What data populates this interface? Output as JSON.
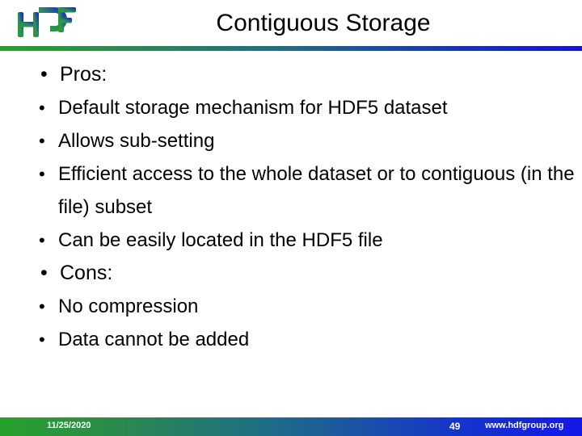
{
  "header": {
    "title": "Contiguous Storage",
    "logo_alt": "HDF",
    "rule_color_left": "#27a12a",
    "rule_color_right": "#1212e0"
  },
  "body": {
    "sections": [
      {
        "label": "Pros:",
        "items": [
          "Default storage mechanism for HDF5 dataset",
          "Allows sub-setting",
          "Efficient access to the whole dataset or to contiguous (in the file) subset",
          "Can be easily located in the HDF5 file"
        ]
      },
      {
        "label": "Cons:",
        "items": [
          "No compression",
          "Data cannot be added"
        ]
      }
    ],
    "bullet_glyph": "•"
  },
  "footer": {
    "date": "11/25/2020",
    "page_number": "49",
    "url": "www.hdfgroup.org",
    "gradient_left": "#27a12a",
    "gradient_right": "#1417e8"
  }
}
